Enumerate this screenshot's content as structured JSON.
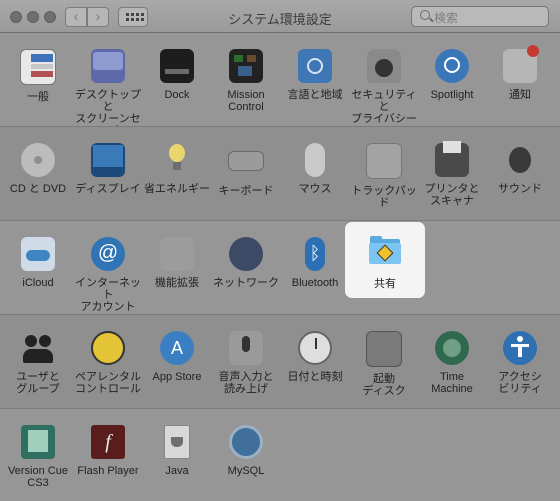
{
  "window": {
    "title": "システム環境設定",
    "search_placeholder": "検索"
  },
  "sections": [
    {
      "panes": [
        {
          "label": "一般",
          "icon": "general-icon"
        },
        {
          "label": "デスクトップと\nスクリーンセーバ",
          "icon": "desktop-icon"
        },
        {
          "label": "Dock",
          "icon": "dock-icon"
        },
        {
          "label": "Mission\nControl",
          "icon": "mission-control-icon"
        },
        {
          "label": "言語と地域",
          "icon": "language-region-icon"
        },
        {
          "label": "セキュリティと\nプライバシー",
          "icon": "security-icon"
        },
        {
          "label": "Spotlight",
          "icon": "spotlight-icon"
        },
        {
          "label": "通知",
          "icon": "notifications-icon"
        }
      ]
    },
    {
      "panes": [
        {
          "label": "CD と DVD",
          "icon": "cd-dvd-icon"
        },
        {
          "label": "ディスプレイ",
          "icon": "display-icon"
        },
        {
          "label": "省エネルギー",
          "icon": "energy-saver-icon"
        },
        {
          "label": "キーボード",
          "icon": "keyboard-icon"
        },
        {
          "label": "マウス",
          "icon": "mouse-icon"
        },
        {
          "label": "トラックパッド",
          "icon": "trackpad-icon"
        },
        {
          "label": "プリンタと\nスキャナ",
          "icon": "printer-icon"
        },
        {
          "label": "サウンド",
          "icon": "sound-icon"
        }
      ]
    },
    {
      "panes": [
        {
          "label": "iCloud",
          "icon": "icloud-icon"
        },
        {
          "label": "インターネット\nアカウント",
          "icon": "internet-accounts-icon"
        },
        {
          "label": "機能拡張",
          "icon": "extensions-icon"
        },
        {
          "label": "ネットワーク",
          "icon": "network-icon"
        },
        {
          "label": "Bluetooth",
          "icon": "bluetooth-icon"
        },
        {
          "label": "共有",
          "icon": "sharing-folder-icon"
        }
      ]
    },
    {
      "panes": [
        {
          "label": "ユーザと\nグループ",
          "icon": "users-groups-icon"
        },
        {
          "label": "ペアレンタル\nコントロール",
          "icon": "parental-controls-icon"
        },
        {
          "label": "App Store",
          "icon": "app-store-icon"
        },
        {
          "label": "音声入力と\n読み上げ",
          "icon": "dictation-speech-icon"
        },
        {
          "label": "日付と時刻",
          "icon": "date-time-icon"
        },
        {
          "label": "起動\nディスク",
          "icon": "startup-disk-icon"
        },
        {
          "label": "Time\nMachine",
          "icon": "time-machine-icon"
        },
        {
          "label": "アクセシ\nビリティ",
          "icon": "accessibility-icon"
        }
      ]
    },
    {
      "panes": [
        {
          "label": "Version Cue\nCS3",
          "icon": "version-cue-icon"
        },
        {
          "label": "Flash Player",
          "icon": "flash-player-icon"
        },
        {
          "label": "Java",
          "icon": "java-icon"
        },
        {
          "label": "MySQL",
          "icon": "mysql-icon"
        }
      ]
    }
  ]
}
